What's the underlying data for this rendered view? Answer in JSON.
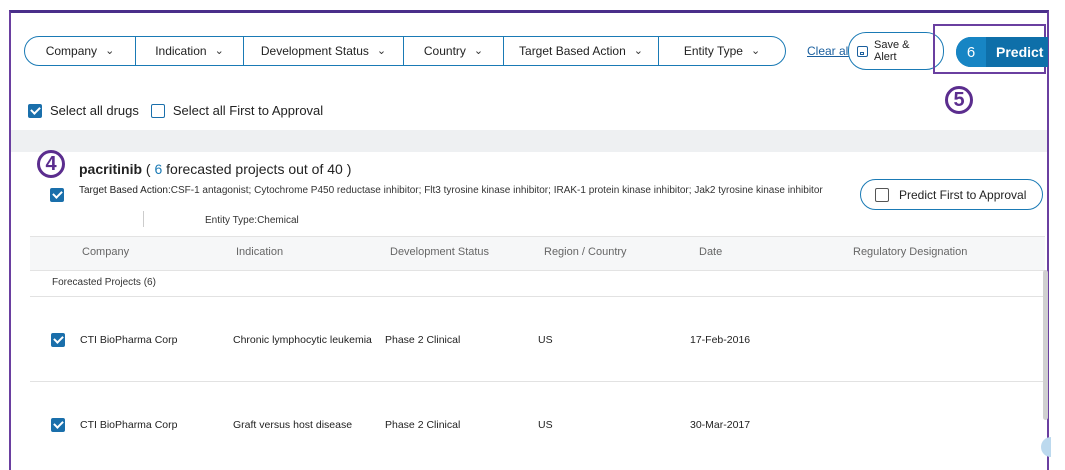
{
  "filters": [
    {
      "label": "Company"
    },
    {
      "label": "Indication"
    },
    {
      "label": "Development Status"
    },
    {
      "label": "Country"
    },
    {
      "label": "Target Based Action"
    },
    {
      "label": "Entity Type"
    }
  ],
  "toolbar": {
    "clear_all": "Clear all",
    "save_alert_line1": "Save &",
    "save_alert_line2": "Alert",
    "predict_count": "6",
    "predict_label": "Predict"
  },
  "annotations": {
    "five": "5",
    "four": "4"
  },
  "select": {
    "all_drugs": "Select all drugs",
    "all_first": "Select all First to Approval"
  },
  "drug": {
    "name": "pacritinib",
    "open_paren": " ( ",
    "forecast_count": "6",
    "forecast_text": "  forecasted projects out of 40  )",
    "tba_key": "Target Based Action:",
    "tba_value": "CSF-1 antagonist; Cytochrome P450 reductase inhibitor; Flt3 tyrosine kinase inhibitor; IRAK-1 protein kinase inhibitor; Jak2 tyrosine kinase inhibitor",
    "entity_key": "Entity Type:",
    "entity_value": "Chemical",
    "predict_first": "Predict First to Approval"
  },
  "table": {
    "headers": [
      "Company",
      "Indication",
      "Development Status",
      "Region / Country",
      "Date",
      "Regulatory Designation"
    ],
    "group_label": "Forecasted Projects (6)",
    "rows": [
      {
        "company": "CTI BioPharma Corp",
        "indication": "Chronic lymphocytic leukemia",
        "status": "Phase 2 Clinical",
        "region": "US",
        "date": "17-Feb-2016",
        "designation": ""
      },
      {
        "company": "CTI BioPharma Corp",
        "indication": "Graft versus host disease",
        "status": "Phase 2 Clinical",
        "region": "US",
        "date": "30-Mar-2017",
        "designation": ""
      }
    ]
  },
  "colors": {
    "accent": "#0e6fa9",
    "annotation": "#5b2d8e",
    "border": "#1a7ab5"
  }
}
